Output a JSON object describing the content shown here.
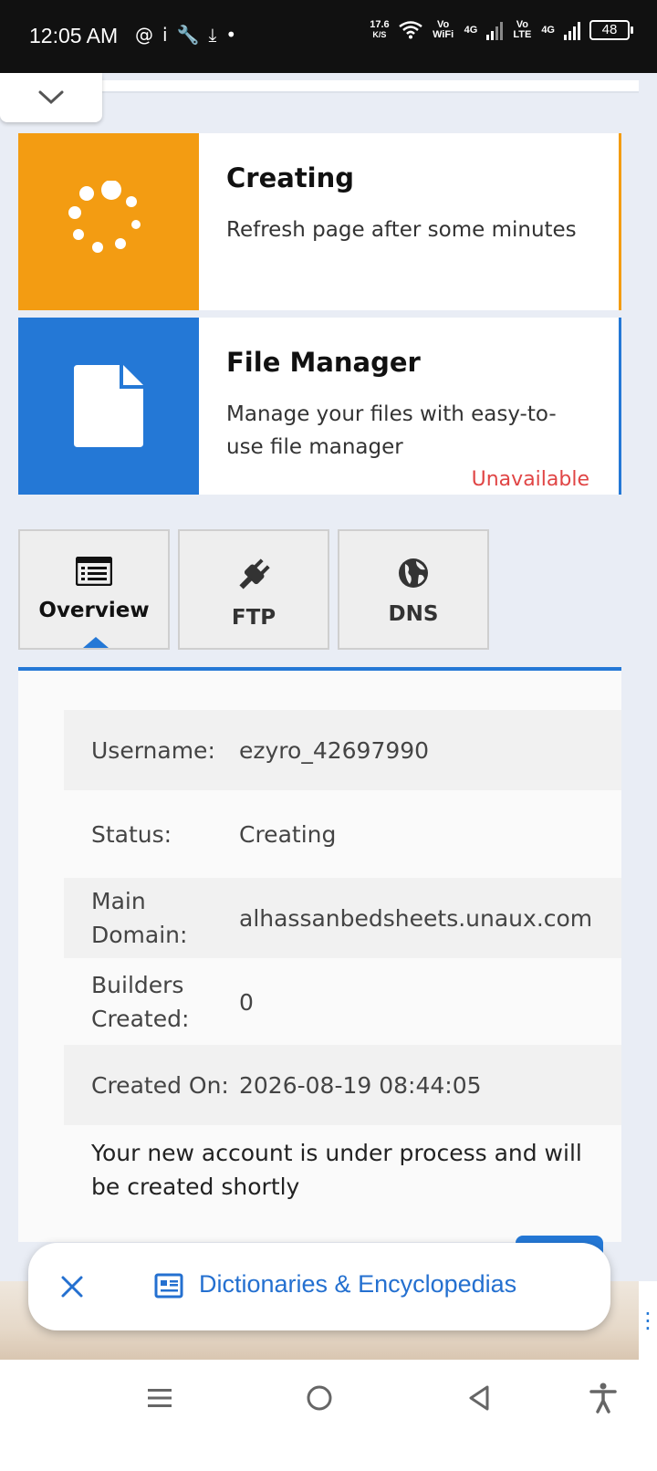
{
  "status_bar": {
    "time": "12:05 AM",
    "net_speed_value": "17.6",
    "net_speed_unit": "K/S",
    "vowifi": "Vo WiFi",
    "lte1": "4G",
    "volte": "Vo LTE",
    "lte2": "4G",
    "battery": "48"
  },
  "cards": {
    "creating": {
      "title": "Creating",
      "description": "Refresh page after some minutes",
      "color": "#f39c12"
    },
    "file_manager": {
      "title": "File Manager",
      "description": "Manage your files with easy-to-use file manager",
      "status": "Unavailable",
      "color": "#2478d6"
    }
  },
  "tabs": [
    {
      "label": "Overview",
      "icon": "list-icon",
      "active": true
    },
    {
      "label": "FTP",
      "icon": "plug-icon",
      "active": false
    },
    {
      "label": "DNS",
      "icon": "globe-icon",
      "active": false
    }
  ],
  "details": [
    {
      "key": "Username:",
      "value": "ezyro_42697990"
    },
    {
      "key": "Status:",
      "value": "Creating"
    },
    {
      "key": "Main Domain:",
      "value": "alhassanbedsheets.unaux.com"
    },
    {
      "key": "Builders Created:",
      "value": "0"
    },
    {
      "key": "Created On:",
      "value": "2026-08-19 08:44:05"
    }
  ],
  "notice": "Your new account is under process and will be created shortly",
  "chip": {
    "label": "Dictionaries & Encyclopedias",
    "icon": "dictionary-icon",
    "close_icon": "close-icon"
  },
  "nav": [
    "menu-icon",
    "home-icon",
    "back-icon",
    "accessibility-icon"
  ]
}
